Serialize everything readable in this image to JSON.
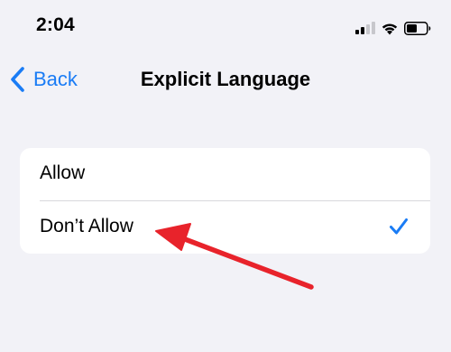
{
  "status_bar": {
    "time": "2:04",
    "icons": [
      "cellular-signal-icon",
      "wifi-icon",
      "battery-icon"
    ]
  },
  "nav": {
    "back_label": "Back",
    "title": "Explicit Language"
  },
  "options": [
    {
      "label": "Allow",
      "selected": false
    },
    {
      "label": "Don’t Allow",
      "selected": true
    }
  ],
  "colors": {
    "accent": "#1a7cf5",
    "background": "#f2f2f7",
    "annotation_arrow": "#e8232b"
  },
  "annotation": {
    "type": "arrow",
    "points_to": "Don’t Allow"
  }
}
